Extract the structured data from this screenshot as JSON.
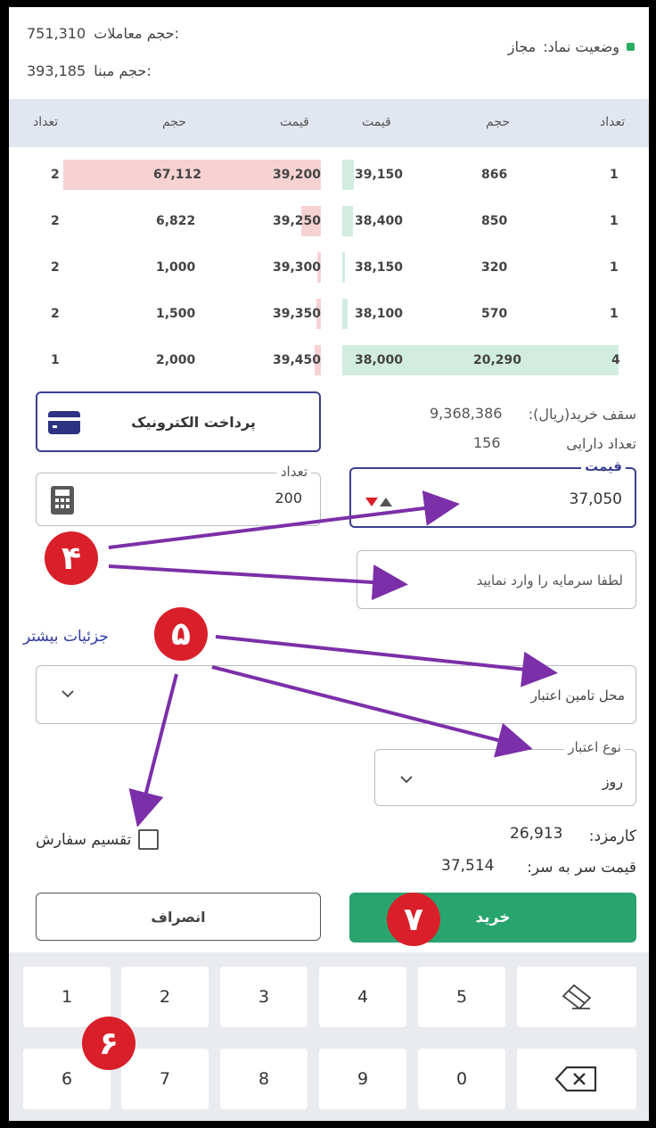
{
  "header": {
    "volume_label": "حجم معاملات:",
    "volume_value": "751,310",
    "base_volume_label": "حجم مبنا:",
    "base_volume_value": "393,185",
    "status_label": "وضعیت نماد:",
    "status_value": "مجاز"
  },
  "order_book": {
    "headers": [
      "تعداد",
      "حجم",
      "قیمت",
      "قیمت",
      "حجم",
      "تعداد"
    ],
    "rows": [
      {
        "sell_count": "2",
        "sell_volume": "67,112",
        "sell_price": "39,200",
        "buy_price": "39,150",
        "buy_volume": "866",
        "buy_count": "1"
      },
      {
        "sell_count": "2",
        "sell_volume": "6,822",
        "sell_price": "39,250",
        "buy_price": "38,400",
        "buy_volume": "850",
        "buy_count": "1"
      },
      {
        "sell_count": "2",
        "sell_volume": "1,000",
        "sell_price": "39,300",
        "buy_price": "38,150",
        "buy_volume": "320",
        "buy_count": "1"
      },
      {
        "sell_count": "2",
        "sell_volume": "1,500",
        "sell_price": "39,350",
        "buy_price": "38,100",
        "buy_volume": "570",
        "buy_count": "1"
      },
      {
        "sell_count": "1",
        "sell_volume": "2,000",
        "sell_price": "39,450",
        "buy_price": "38,000",
        "buy_volume": "20,290",
        "buy_count": "4"
      }
    ]
  },
  "account": {
    "buy_cap_label": "سقف خرید(ریال):",
    "buy_cap_value": "9,368,386",
    "assets_label": "تعداد دارایی",
    "assets_value": "156",
    "epay_button": "پرداخت الکترونیک"
  },
  "order_form": {
    "price_legend": "قیمت",
    "price_value": "37,050",
    "quantity_legend": "تعداد",
    "quantity_value": "200",
    "capital_placeholder": "لطفا سرمایه را وارد نمایید",
    "more_details": "جزئیات بیشتر",
    "credit_source_placeholder": "محل تامین اعتبار",
    "validity_legend": "نوع اعتبار",
    "validity_value": "روز",
    "split_order_label": "تقسیم سفارش",
    "fee_label": "کارمزد:",
    "fee_value": "26,913",
    "breakeven_label": "قیمت سر به سر:",
    "breakeven_value": "37,514",
    "buy_button": "خرید",
    "cancel_button": "انصراف"
  },
  "keypad": {
    "row1": [
      "1",
      "2",
      "3",
      "4",
      "5"
    ],
    "row2": [
      "6",
      "7",
      "8",
      "9",
      "0"
    ],
    "icons": [
      "eraser-icon",
      "backspace-icon"
    ]
  },
  "annotations": {
    "badge_4": "۴",
    "badge_5": "۵",
    "badge_6": "۶",
    "badge_7": "۷"
  },
  "colors": {
    "buy_green": "#28a46e",
    "sell_red": "#f7d2d3",
    "bid_green": "#d2ede0",
    "accent_blue": "#3a3f8f",
    "annotation_purple": "#7b2fa8",
    "badge_red": "#d9202a"
  }
}
